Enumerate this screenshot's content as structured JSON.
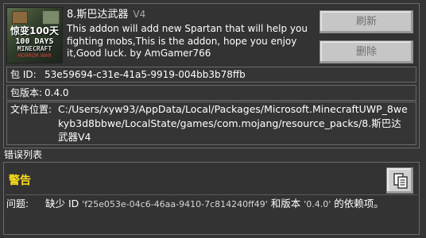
{
  "pack": {
    "thumbnail": {
      "line1": "惊变100天",
      "line2": "100 DAYS",
      "line3": "MINECRAFT",
      "line4": "HORROR WAR"
    },
    "name": "8.斯巴达武器",
    "version_badge": "V4",
    "description": "This addon will add new Spartan that will help you fighting mobs,This is the addon, hope you enjoy it,Good luck. by AmGamer766"
  },
  "buttons": {
    "refresh": "刷新",
    "delete": "删除"
  },
  "details": {
    "package_id_label": "包 ID:",
    "package_id": "53e59694-c31e-41a5-9919-004bb3b78ffb",
    "version_label": "包版本:",
    "version": "0.4.0",
    "path_label": "文件位置:",
    "path": "C:/Users/xyw93/AppData/Local/Packages/Microsoft.MinecraftUWP_8wekyb3d8bbwe/LocalState/games/com.mojang/resource_packs/8.斯巴达武器V4"
  },
  "errors": {
    "heading": "错误列表",
    "severity": "警告",
    "issue_label": "问题:",
    "issue_prefix": "缺少 ID ",
    "missing_id": "'f25e053e-04c6-46aa-9410-7c814240ff49'",
    "issue_middle": " 和版本 ",
    "missing_version": "'0.4.0'",
    "issue_suffix": " 的依赖项。"
  },
  "colors": {
    "background": "#353535",
    "warning": "#ffe01a",
    "button": "#c6c6c6"
  },
  "icons": {
    "copy": "clipboard-copy-icon"
  }
}
